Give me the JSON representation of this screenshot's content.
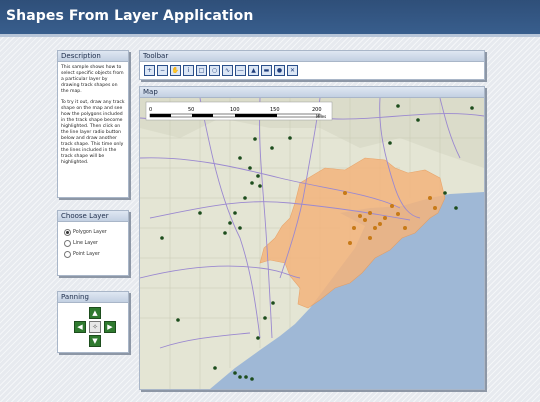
{
  "app": {
    "title": "Shapes From Layer Application"
  },
  "description": {
    "header": "Description",
    "paragraphs": [
      "This sample shows how to select specific objects from a particular layer by drawing track shapes on the map.",
      "To try it out, draw any track shape on the map and see how the polygons included in the track shape become highlighted. Then click on the line layer radio button below and draw another track shape. This time only the lines included in the track shape will be highlighted."
    ]
  },
  "choose_layer": {
    "header": "Choose Layer",
    "options": [
      "Polygon Layer",
      "Line Layer",
      "Point Layer"
    ],
    "selected": "Polygon Layer"
  },
  "panning": {
    "header": "Panning"
  },
  "toolbar": {
    "header": "Toolbar",
    "tools": [
      "zoom-in-icon",
      "zoom-out-icon",
      "pan-icon",
      "info-icon",
      "select-icon",
      "circle-select-icon",
      "polyline-icon",
      "line-icon",
      "polygon-icon",
      "rectangle-icon",
      "radius-icon",
      "clear-icon"
    ]
  },
  "map": {
    "header": "Map",
    "scale": {
      "ticks": [
        "0",
        "50",
        "100",
        "150",
        "200"
      ],
      "unit": "Miles"
    },
    "colors": {
      "land": "#e4e5d4",
      "water": "#9fb8d6",
      "highlight": "#f4b47c",
      "road": "#9b89d0",
      "point": "#1d4d1d"
    }
  }
}
